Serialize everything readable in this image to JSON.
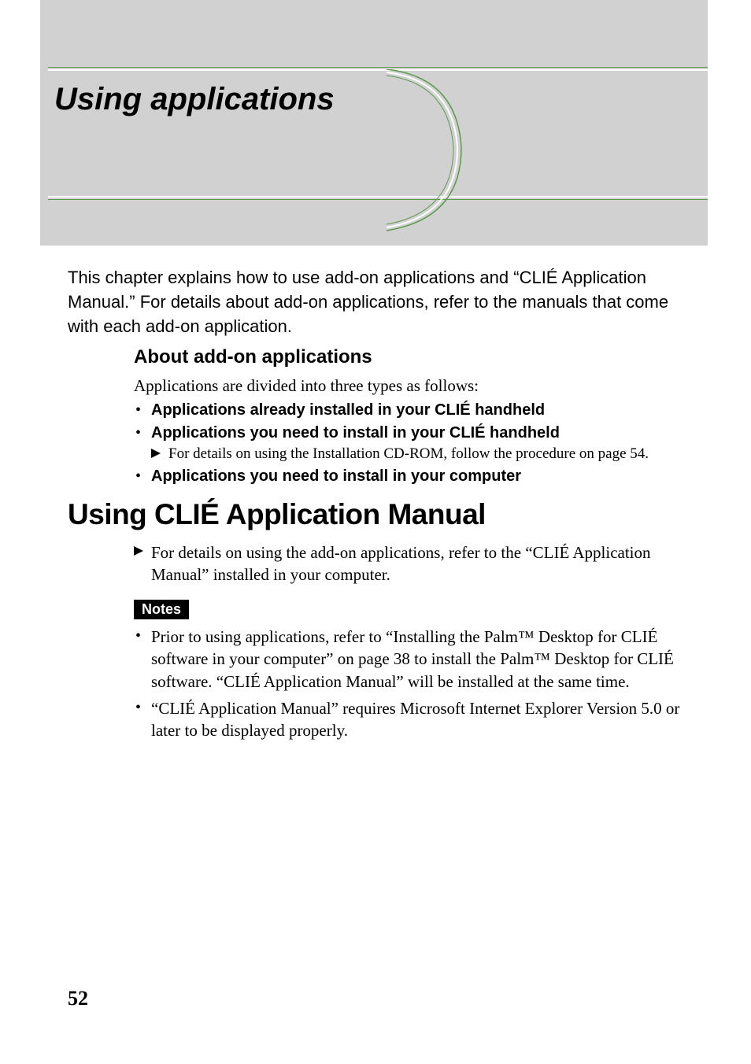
{
  "header": {
    "chapter_title": "Using applications"
  },
  "intro": "This chapter explains how to use add-on applications and “CLIÉ Application Manual.” For details about add-on applications, refer to the manuals that come with each add-on application.",
  "addon": {
    "heading": "About add-on applications",
    "intro": "Applications are divided into three types as follows:",
    "items": [
      {
        "label": "Applications already installed in your CLIÉ handheld",
        "sub": null
      },
      {
        "label": "Applications you need to install in your CLIÉ handheld",
        "sub": "For details on using the Installation CD-ROM, follow the procedure on page 54."
      },
      {
        "label": "Applications you need to install in your computer",
        "sub": null
      }
    ]
  },
  "manual": {
    "heading": "Using CLIÉ Application Manual",
    "arrow_text": "For details on using the add-on applications, refer to the “CLIÉ Application Manual” installed in your computer."
  },
  "notes": {
    "badge": "Notes",
    "items": [
      "Prior to using applications, refer to “Installing the Palm™ Desktop for CLIÉ software in your computer” on page 38 to install the Palm™ Desktop for CLIÉ software. “CLIÉ Application Manual” will be installed at the same time.",
      "“CLIÉ Application Manual” requires Microsoft Internet Explorer Version 5.0 or later to be displayed properly."
    ]
  },
  "page_number": "52"
}
